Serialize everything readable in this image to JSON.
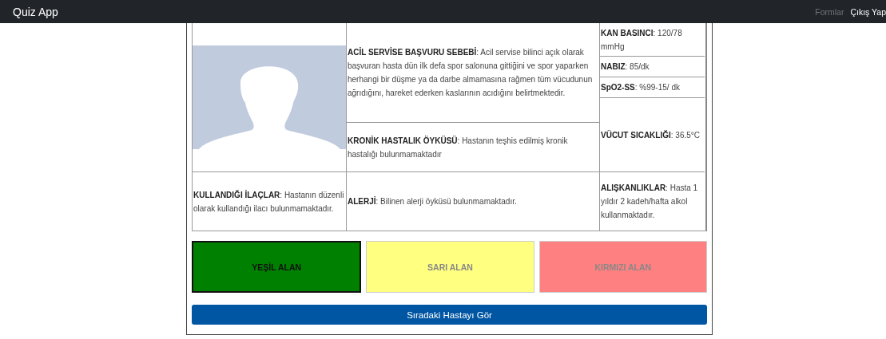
{
  "navbar": {
    "brand": "Quiz App",
    "links": [
      {
        "label": "Formlar",
        "disabled": true
      },
      {
        "label": "Çıkış Yap",
        "disabled": false
      }
    ]
  },
  "patient": {
    "complaint": "**ACİL SERVİSE BAŞVURU SEBEBİ**: Acil servise bilinci açık olarak başvuran hasta dün ilk defa spor salonuna gittiğini ve spor yaparken herhangi bir düşme ya da darbe almamasına rağmen tüm vücudunun ağrıdığını, hareket ederken kaslarının acıdığını belirtmektedir.",
    "chronic": "**KRONİK HASTALIK ÖYKÜSÜ**: Hastanın teşhis edilmiş kronik hastalığı bulunmamaktadır",
    "vitals": [
      "**KAN BASINCI**: 120/78 mmHg",
      "**NABIZ**: 85/dk",
      "**SpO2-SS**: %99-15/ dk",
      "**VÜCUT SICAKLIĞI**: 36.5°C"
    ],
    "medications": "**KULLANDIĞI İLAÇLAR**: Hastanın düzenli olarak kullandığı ilacı bulunmamaktadır.",
    "allergy": "**ALERJİ**: Bilinen alerji öyküsü bulunmamaktadır.",
    "habits": "**ALIŞKANLIKLAR**: Hasta 1 yıldır 2 kadeh/hafta alkol kullanmaktadır."
  },
  "triage": [
    {
      "label": "YEŞİL ALAN",
      "color": "#008000",
      "selected": true
    },
    {
      "label": "SARI ALAN",
      "color": "#ffff80",
      "selected": false
    },
    {
      "label": "KIRMIZI ALAN",
      "color": "#ff8080",
      "selected": false
    }
  ],
  "next_button": "Sıradaki Hastayı Gör"
}
